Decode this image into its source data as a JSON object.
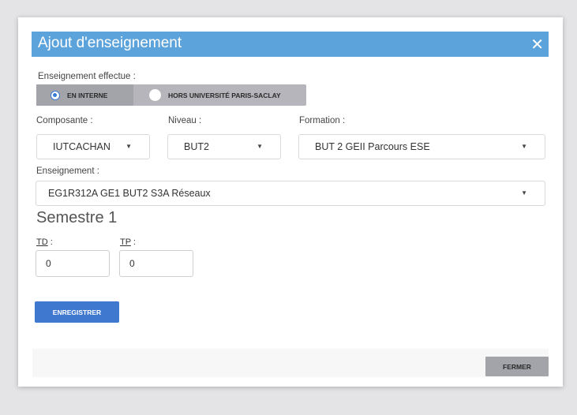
{
  "dialog": {
    "title": "Ajout d'enseignement",
    "close_glyph": "✕"
  },
  "enseignement_effectue": {
    "label": "Enseignement effectue :",
    "options": [
      "EN INTERNE",
      "HORS UNIVERSITÉ PARIS-SACLAY"
    ],
    "selected": "EN INTERNE"
  },
  "composante": {
    "label": "Composante :",
    "value": "IUTCACHAN"
  },
  "niveau": {
    "label": "Niveau :",
    "value": "BUT2"
  },
  "formation": {
    "label": "Formation :",
    "value": "BUT 2 GEII Parcours ESE"
  },
  "enseignement": {
    "label": "Enseignement :",
    "value": "EG1R312A GE1 BUT2 S3A Réseaux"
  },
  "semestre": {
    "title": "Semestre 1"
  },
  "td": {
    "label_abbr": "TD",
    "label_suffix": " :",
    "value": "0"
  },
  "tp": {
    "label_abbr": "TP",
    "label_suffix": " :",
    "value": "0"
  },
  "buttons": {
    "save": "ENREGISTRER",
    "close": "FERMER"
  },
  "colors": {
    "header": "#5da3db",
    "primary_button": "#3f78cf",
    "secondary_button": "#a3a3aa"
  },
  "icons": {
    "close": "close-icon",
    "caret": "caret-down-icon"
  }
}
